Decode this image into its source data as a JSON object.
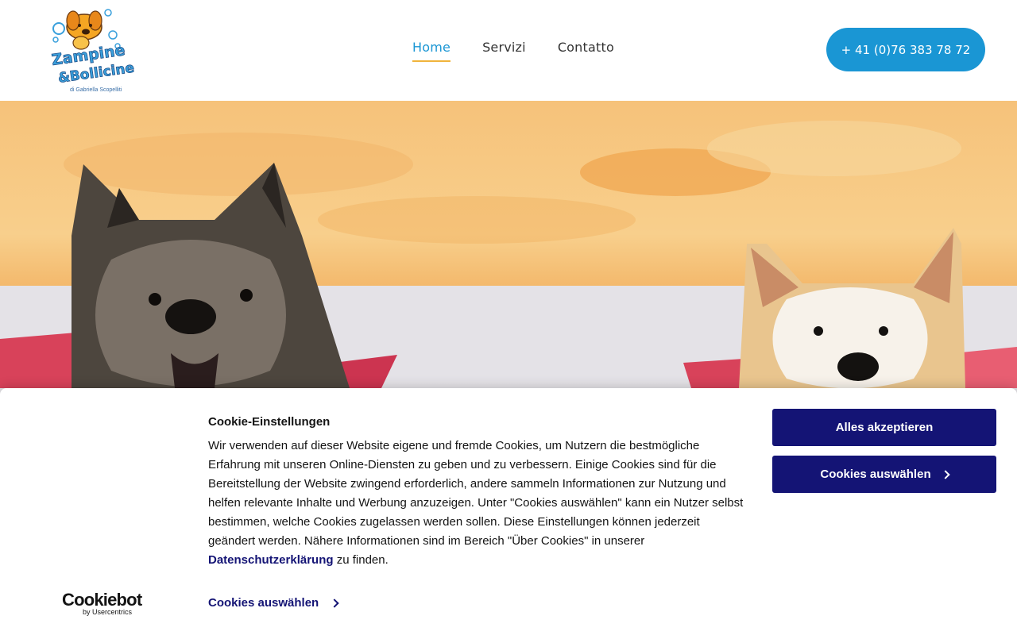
{
  "header": {
    "logo": {
      "brand": "Zampine & Bollicine",
      "subtitle": "di Gabriella Scopelliti"
    },
    "nav": [
      {
        "label": "Home",
        "active": true
      },
      {
        "label": "Servizi",
        "active": false
      },
      {
        "label": "Contatto",
        "active": false
      }
    ],
    "phone_button": "+ 41 (0)76 383 78 72"
  },
  "colors": {
    "accent": "#1a96d4",
    "nav_underline": "#f0b43c",
    "cookie_primary": "#141475"
  },
  "hero": {
    "image": "two-akita-dogs-photo"
  },
  "cookie_banner": {
    "title": "Cookie-Einstellungen",
    "text_before_link": "Wir verwenden auf dieser Website eigene und fremde Cookies, um Nutzern die bestmögliche Erfahrung mit unseren Online-Diensten zu geben und zu verbessern. Einige Cookies sind für die Bereitstellung der Website zwingend erforderlich, andere sammeln Informationen zur Nutzung und helfen relevante Inhalte und Werbung anzuzeigen. Unter \"Cookies auswählen\" kann ein Nutzer selbst bestimmen, welche Cookies zugelassen werden sollen. Diese Einstellungen können jederzeit geändert werden. Nähere Informationen sind im Bereich \"Über Cookies\" in unserer ",
    "link_text": "Datenschutzerklärung",
    "text_after_link": " zu finden.",
    "accept_button": "Alles akzeptieren",
    "select_button": "Cookies auswählen",
    "select_link": "Cookies auswählen",
    "provider_logo": "Cookiebot",
    "provider_sub": "by Usercentrics"
  }
}
